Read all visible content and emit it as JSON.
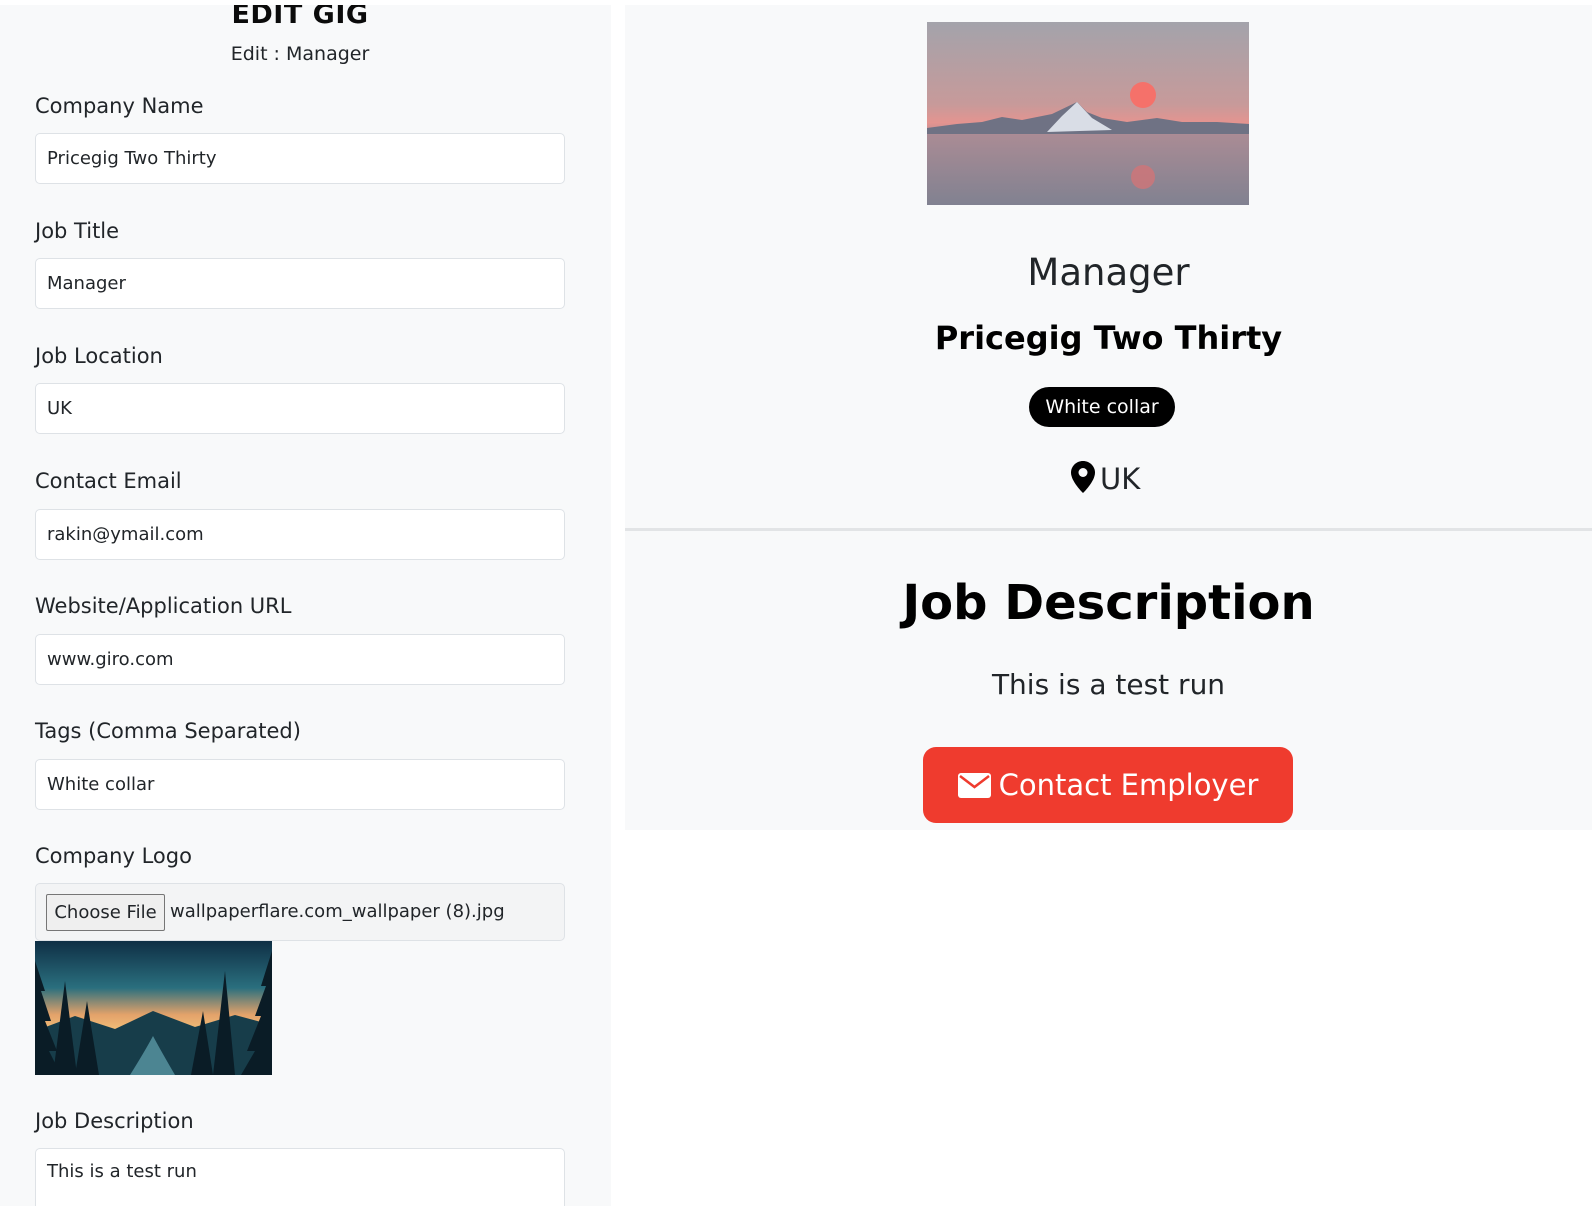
{
  "form": {
    "title": "EDIT GIG",
    "subtitle": "Edit : Manager",
    "fields": {
      "company_name": {
        "label": "Company Name",
        "value": "Pricegig Two Thirty"
      },
      "job_title": {
        "label": "Job Title",
        "value": "Manager"
      },
      "job_location": {
        "label": "Job Location",
        "value": "UK"
      },
      "contact_email": {
        "label": "Contact Email",
        "value": "rakin@ymail.com"
      },
      "website": {
        "label": "Website/Application URL",
        "value": "www.giro.com"
      },
      "tags": {
        "label": "Tags (Comma Separated)",
        "value": "White collar"
      },
      "logo": {
        "label": "Company Logo",
        "button": "Choose File",
        "file_name": "wallpaperflare.com_wallpaper (8).jpg"
      },
      "description": {
        "label": "Job Description",
        "value": "This is a test run"
      }
    }
  },
  "preview": {
    "job_title": "Manager",
    "company": "Pricegig Two Thirty",
    "tag": "White collar",
    "location": "UK",
    "description_heading": "Job Description",
    "description": "This is a test run",
    "contact_button": "Contact Employer"
  },
  "colors": {
    "panel_bg": "#f8f9fa",
    "tag_bg": "#000000",
    "button_accent": "#ef3b2e"
  },
  "icons": {
    "location": "map-marker-icon",
    "contact": "envelope-icon"
  }
}
